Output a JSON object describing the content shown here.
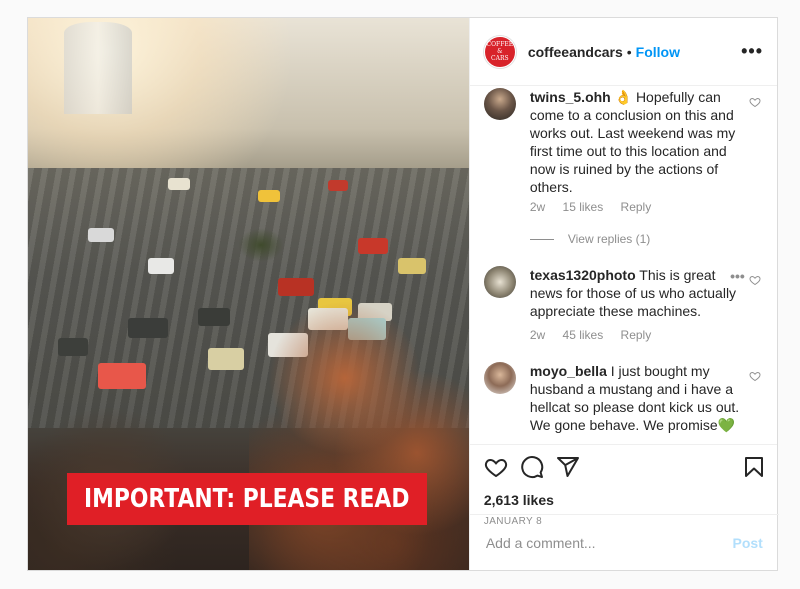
{
  "banner": {
    "text": "IMPORTANT: PLEASE READ"
  },
  "header": {
    "username": "coffeeandcars",
    "separator": "•",
    "follow_label": "Follow",
    "more_label": "•••",
    "logo_line1": "COFFEE",
    "logo_line2": "&",
    "logo_line3": "CARS"
  },
  "comments": [
    {
      "username": "twins_5.ohh",
      "text": "👌 Hopefully can come to a conclusion on this and works out. Last weekend was my first time out to this location and now is ruined by the actions of others.",
      "age": "2w",
      "likes": "15 likes",
      "reply": "Reply",
      "view_replies": "View replies (1)"
    },
    {
      "username": "texas1320photo",
      "text": "This is great news for those of us who actually appreciate these machines.",
      "age": "2w",
      "likes": "45 likes",
      "reply": "Reply",
      "more": "•••"
    },
    {
      "username": "moyo_bella",
      "text": "I just bought my husband a mustang and i have a hellcat so please dont kick us out. We gone behave. We promise💚"
    }
  ],
  "icons": {
    "like": "heart-icon",
    "comment": "comment-icon",
    "share": "share-icon",
    "save": "bookmark-icon"
  },
  "post": {
    "likes": "2,613 likes",
    "date": "JANUARY 8"
  },
  "add_comment": {
    "placeholder": "Add a comment...",
    "post_label": "Post"
  },
  "colors": {
    "accent": "#0095f6",
    "banner_red": "#e01f26",
    "post_disabled": "#b2dffc"
  }
}
